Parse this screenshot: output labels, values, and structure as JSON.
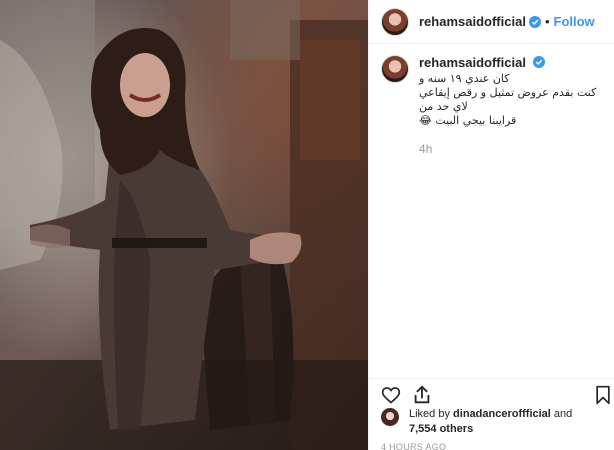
{
  "post": {
    "username": "rehamsaidofficial",
    "separator": "•",
    "follow_label": "Follow",
    "photo_icon": "post-photo",
    "caption_user": "rehamsaidofficial",
    "caption_lines": [
      "كان عندي ١٩ سنه و",
      "كنت بقدم عروض تمثيل و رقص إيقاعي لاي حد من",
      "قرايبنا بيجي البيت 😂"
    ],
    "comment_time": "4h",
    "liked_by_prefix": "Liked by",
    "liked_by_user": "dinadanceroffficial",
    "liked_by_and": "and",
    "others_count": "7,554 others",
    "timestamp": "4 HOURS AGO"
  },
  "icons": {
    "verified": "verified-badge-icon",
    "like": "heart-icon",
    "share": "share-icon",
    "save": "bookmark-icon"
  },
  "colors": {
    "link": "#3897f0",
    "verified": "#3897f0",
    "muted": "#999999",
    "text": "#262626"
  }
}
